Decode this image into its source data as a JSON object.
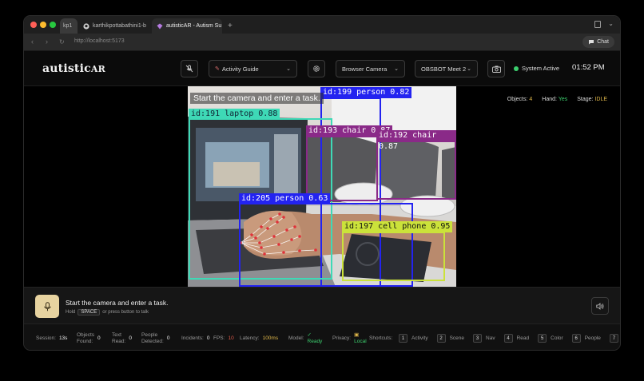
{
  "browser": {
    "tabs": [
      {
        "label": "kp1"
      },
      {
        "label": "karthikpottabathini1-b"
      },
      {
        "label": "autisticAR - Autism Su"
      }
    ],
    "url": "http://localhost:5173",
    "chat_label": "Chat"
  },
  "header": {
    "logo_main": "autistic",
    "logo_suffix": "AR",
    "activity_guide": "Activity Guide",
    "camera_source": "Browser Camera",
    "camera_device": "OBSBOT Meet 2",
    "status": "System Active",
    "time": "01:52 PM"
  },
  "stats": {
    "objects_label": "Objects:",
    "objects_value": "4",
    "hand_label": "Hand:",
    "hand_value": "Yes",
    "stage_label": "Stage:",
    "stage_value": "IDLE"
  },
  "video": {
    "overlay_text": "Start the camera and enter a task.",
    "detections": [
      {
        "label": "id:199 person 0.82",
        "color": "#2323f0"
      },
      {
        "label": "id:191 laptop 0.88",
        "color": "#3ed9b6"
      },
      {
        "label": "id:193 chair 0.87",
        "color": "#8a2a88"
      },
      {
        "label": "id:192 chair 0.87",
        "color": "#8a2a88"
      },
      {
        "label": "id:205 person 0.63",
        "color": "#2323f0"
      },
      {
        "label": "id:197 cell phone 0.95",
        "color": "#cbe23a"
      }
    ]
  },
  "prompt": {
    "message": "Start the camera and enter a task.",
    "hint_prefix": "Hold",
    "hint_key": "SPACE",
    "hint_suffix": "or press button to talk"
  },
  "statusbar": {
    "session_label": "Session:",
    "session_value": "13s",
    "objects_label_1": "Objects",
    "objects_label_2": "Found:",
    "objects_value": "0",
    "text_label_1": "Text",
    "text_label_2": "Read:",
    "text_value": "0",
    "people_label_1": "People",
    "people_label_2": "Detected:",
    "people_value": "0",
    "incidents_label": "Incidents:",
    "incidents_value": "0",
    "fps_label": "FPS:",
    "fps_value": "10",
    "latency_label": "Latency:",
    "latency_value": "100ms",
    "model_label": "Model:",
    "model_value": "Ready",
    "privacy_label": "Privacy:",
    "privacy_value": "Local",
    "shortcuts_label": "Shortcuts:",
    "shortcuts": [
      {
        "key": "1",
        "label": "Activity"
      },
      {
        "key": "2",
        "label": "Scene"
      },
      {
        "key": "3",
        "label": "Nav"
      },
      {
        "key": "4",
        "label": "Read"
      },
      {
        "key": "5",
        "label": "Color"
      },
      {
        "key": "6",
        "label": "People"
      },
      {
        "key": "7",
        "label": "("
      }
    ]
  }
}
